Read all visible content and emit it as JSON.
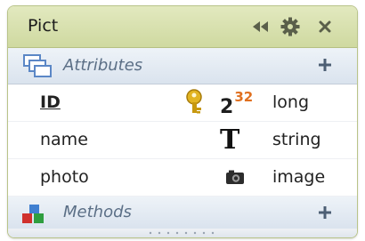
{
  "window": {
    "title": "Pict",
    "controls": {
      "collapse_icon": "double-chevron-left-icon",
      "settings_icon": "gear-icon",
      "close_icon": "close-icon"
    }
  },
  "sections": {
    "attributes": {
      "label": "Attributes",
      "icon": "attributes-stack-icon",
      "add_icon": "plus-icon"
    },
    "methods": {
      "label": "Methods",
      "icon": "methods-blocks-icon",
      "add_icon": "plus-icon"
    }
  },
  "attributes": [
    {
      "name": "ID",
      "type": "long",
      "type_icon": "integer-2-32-icon",
      "primary_key": true,
      "key_icon": "key-icon",
      "type_icon_text": {
        "base": "2",
        "exp": "32"
      }
    },
    {
      "name": "name",
      "type": "string",
      "type_icon": "text-T-icon",
      "type_icon_text": "T"
    },
    {
      "name": "photo",
      "type": "image",
      "type_icon": "camera-icon"
    }
  ],
  "colors": {
    "title_bar": "#d6dfab",
    "section_header": "#e3eaf3",
    "section_text": "#5b6f86",
    "key_gold": "#d4a017",
    "int_exp_orange": "#e07020"
  }
}
